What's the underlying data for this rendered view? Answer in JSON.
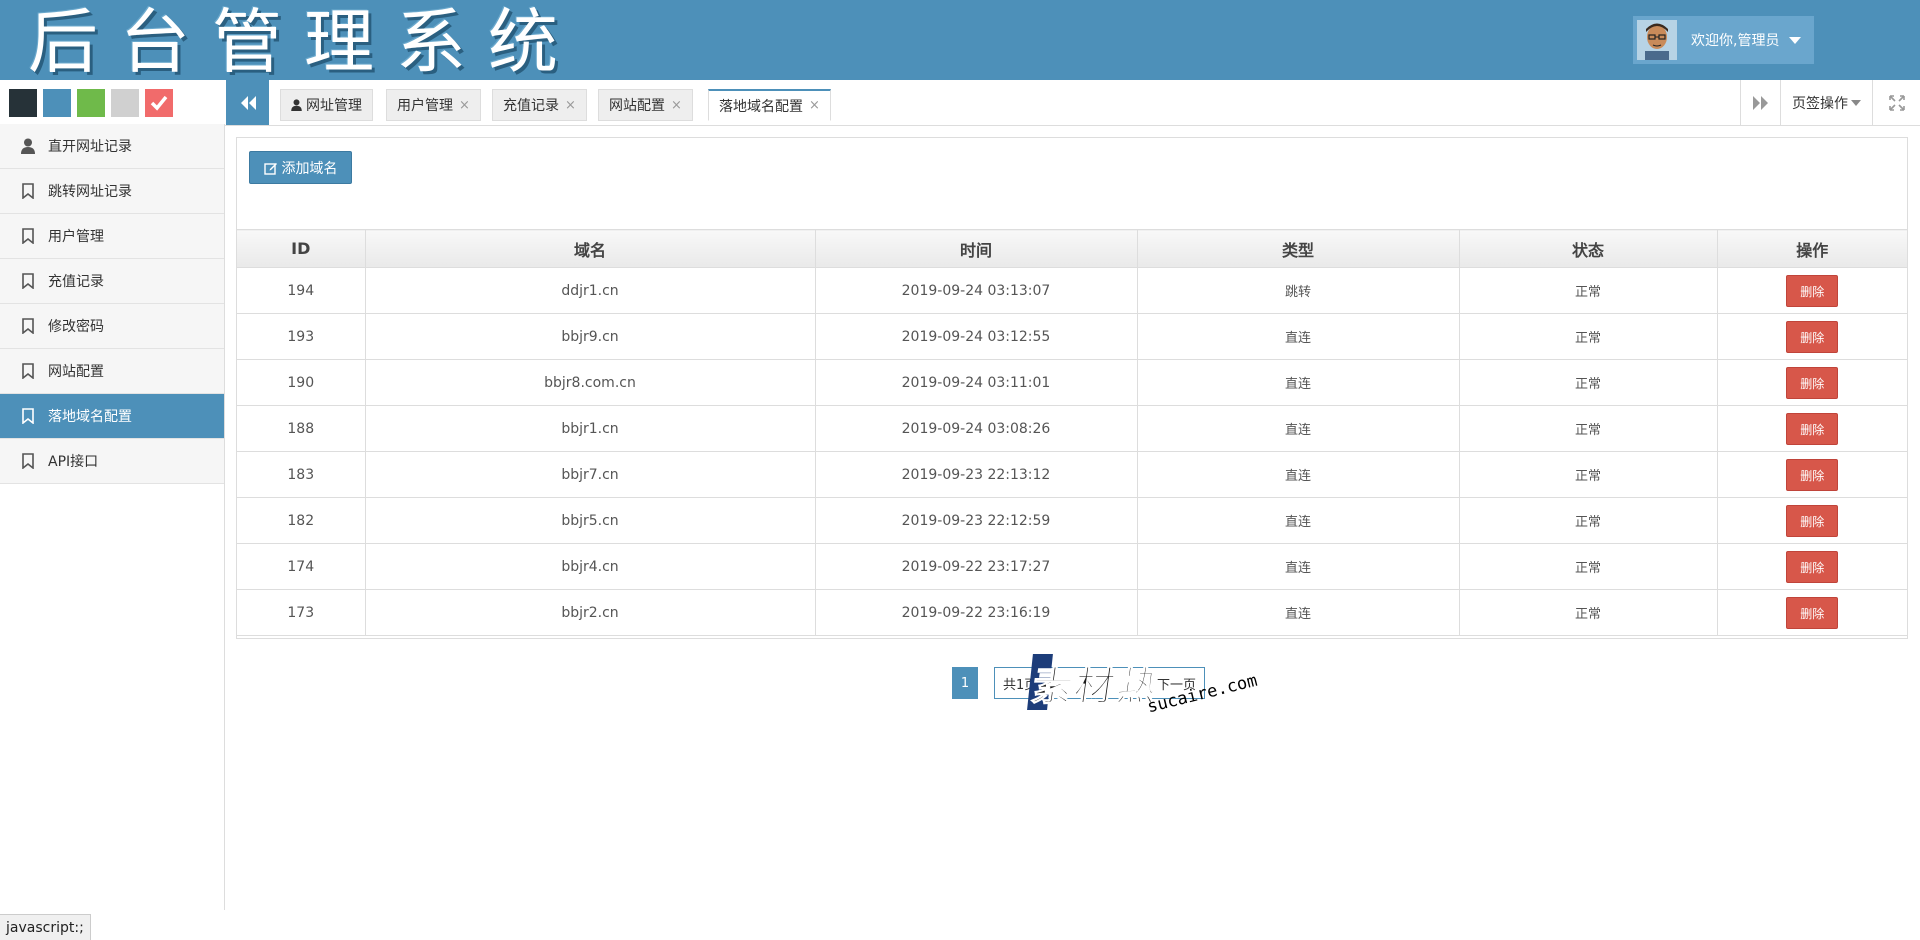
{
  "header": {
    "logo_title": "后台管理系统",
    "user_label": "欢迎你,管理员"
  },
  "theme_swatches": [
    {
      "name": "dark",
      "color": "#263238"
    },
    {
      "name": "blue",
      "color": "#4d90b9"
    },
    {
      "name": "green",
      "color": "#6fba4a"
    },
    {
      "name": "gray",
      "color": "#d0d0d0"
    },
    {
      "name": "red",
      "color": "#f16b6b",
      "checked": true
    }
  ],
  "sidebar": {
    "items": [
      {
        "label": "直开网址记录",
        "icon": "user-icon"
      },
      {
        "label": "跳转网址记录",
        "icon": "bookmark-icon"
      },
      {
        "label": "用户管理",
        "icon": "bookmark-icon"
      },
      {
        "label": "充值记录",
        "icon": "bookmark-icon"
      },
      {
        "label": "修改密码",
        "icon": "bookmark-icon"
      },
      {
        "label": "网站配置",
        "icon": "bookmark-icon"
      },
      {
        "label": "落地域名配置",
        "icon": "bookmark-icon",
        "active": true
      },
      {
        "label": "API接口",
        "icon": "bookmark-icon"
      }
    ]
  },
  "tabs": [
    {
      "label": "网址管理",
      "closable": false,
      "icon": "user-icon"
    },
    {
      "label": "用户管理",
      "closable": true
    },
    {
      "label": "充值记录",
      "closable": true
    },
    {
      "label": "网站配置",
      "closable": true
    },
    {
      "label": "落地域名配置",
      "closable": true,
      "active": true
    }
  ],
  "tab_actions": {
    "page_ops_label": "页签操作"
  },
  "toolbar": {
    "add_domain_label": "添加域名"
  },
  "table": {
    "columns": [
      "ID",
      "域名",
      "时间",
      "类型",
      "状态",
      "操作"
    ],
    "rows": [
      {
        "id": "194",
        "domain": "ddjr1.cn",
        "time": "2019-09-24 03:13:07",
        "type": "跳转",
        "status": "正常",
        "action": "删除"
      },
      {
        "id": "193",
        "domain": "bbjr9.cn",
        "time": "2019-09-24 03:12:55",
        "type": "直连",
        "status": "正常",
        "action": "删除"
      },
      {
        "id": "190",
        "domain": "bbjr8.com.cn",
        "time": "2019-09-24 03:11:01",
        "type": "直连",
        "status": "正常",
        "action": "删除"
      },
      {
        "id": "188",
        "domain": "bbjr1.cn",
        "time": "2019-09-24 03:08:26",
        "type": "直连",
        "status": "正常",
        "action": "删除"
      },
      {
        "id": "183",
        "domain": "bbjr7.cn",
        "time": "2019-09-23 22:13:12",
        "type": "直连",
        "status": "正常",
        "action": "删除"
      },
      {
        "id": "182",
        "domain": "bbjr5.cn",
        "time": "2019-09-23 22:12:59",
        "type": "直连",
        "status": "正常",
        "action": "删除"
      },
      {
        "id": "174",
        "domain": "bbjr4.cn",
        "time": "2019-09-22 23:17:27",
        "type": "直连",
        "status": "正常",
        "action": "删除"
      },
      {
        "id": "173",
        "domain": "bbjr2.cn",
        "time": "2019-09-22 23:16:19",
        "type": "直连",
        "status": "正常",
        "action": "删除"
      }
    ]
  },
  "pagination": {
    "current_page": "1",
    "total_label": "共1页",
    "next_label": "下一页"
  },
  "watermark": {
    "brand": "素材熱",
    "domain": "sucaire.com"
  },
  "statusbar": {
    "text": "javascript:;"
  }
}
